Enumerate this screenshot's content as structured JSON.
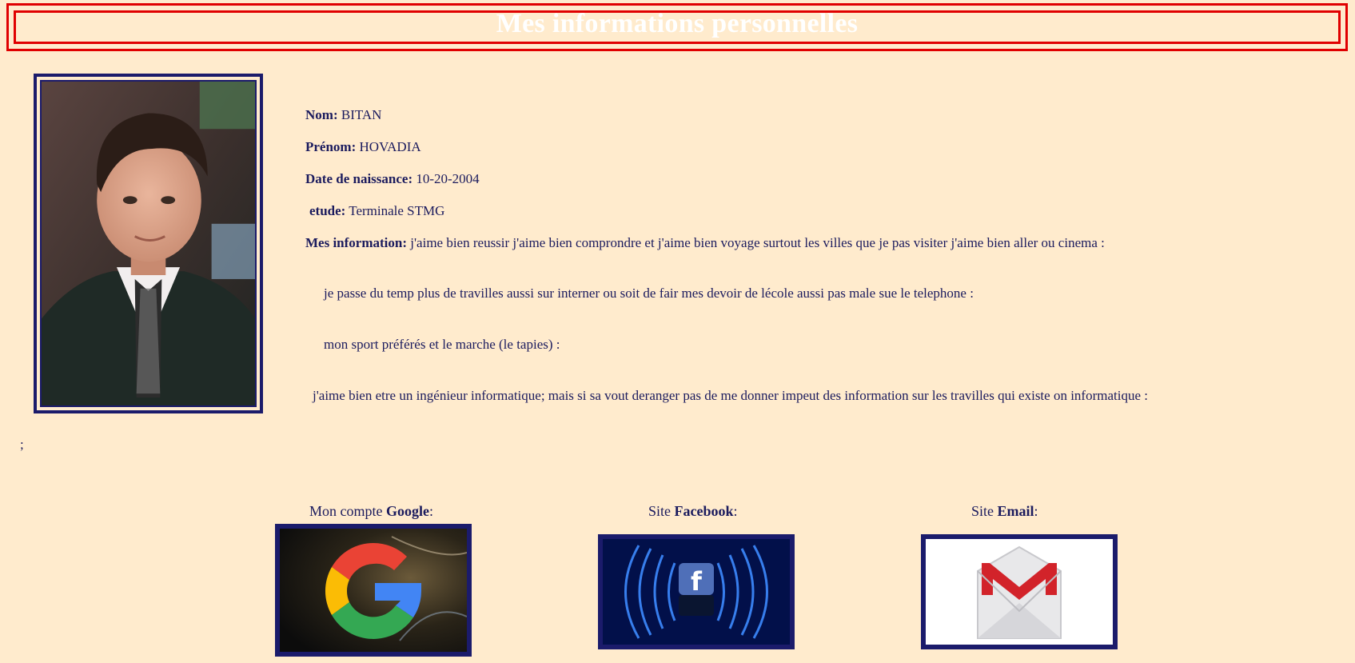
{
  "header": {
    "title": "Mes informations personnelles"
  },
  "profile": {
    "photo_alt": "Photo de profil",
    "fields": [
      {
        "label": "Nom:",
        "value": " BITAN"
      },
      {
        "label": "Prénom:",
        "value": " HOVADIA"
      },
      {
        "label": "Date de naissance:",
        "value": " 10-20-2004"
      },
      {
        "label": "etude:",
        "value": " Terminale STMG"
      },
      {
        "label": "Mes information:",
        "value": " j'aime bien reussir j'aime bien comprondre et j'aime bien voyage surtout les villes que je pas visiter j'aime bien aller ou cinema :"
      }
    ],
    "paragraphs": [
      "je passe du temp plus de travilles aussi sur interner ou soit de fair mes devoir de lécole aussi pas male sue le telephone :",
      "mon sport préférés et le marche (le tapies) :",
      "j'aime bien etre un ingénieur informatique; mais si sa vout deranger pas de me donner impeut des information sur les travilles qui existe on informatique :"
    ],
    "trailing": ";"
  },
  "links": [
    {
      "prefix": "Mon compte ",
      "bold": "Google",
      "suffix": ":",
      "icon": "google-icon"
    },
    {
      "prefix": "Site ",
      "bold": "Facebook",
      "suffix": ":",
      "icon": "facebook-icon"
    },
    {
      "prefix": "Site ",
      "bold": "Email",
      "suffix": ":",
      "icon": "gmail-icon"
    }
  ],
  "colors": {
    "background": "#ffebcd",
    "header_border": "#e00000",
    "text": "#1b1b5e",
    "frame": "#1b1b6b"
  }
}
